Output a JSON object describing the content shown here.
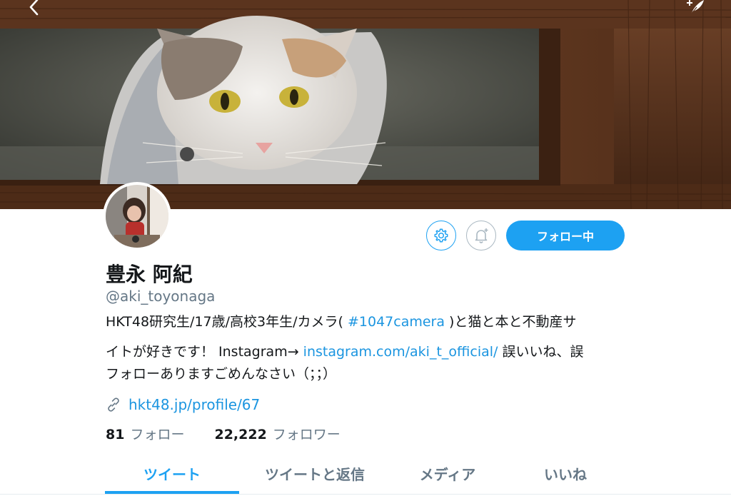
{
  "profile": {
    "display_name": "豊永 阿紀",
    "handle": "@aki_toyonaga",
    "bio": {
      "line1_text": "HKT48研究生/17歳/高校3年生/カメラ(",
      "line1_hashtag": "#1047camera",
      "line1_after": ")と猫と本と不動産サ",
      "line2_text": "イトが好きです！ Instagram→",
      "line2_link": "instagram.com/aki_t_official/",
      "line2_after": " 誤いいね、誤",
      "line3_text": "フォローありますごめんなさい（；；）"
    },
    "website": "hkt48.jp/profile/67"
  },
  "stats": {
    "following_count": "81",
    "following_label": "フォロー",
    "followers_count": "22,222",
    "followers_label": "フォロワー"
  },
  "actions": {
    "follow_label": "フォロー中",
    "settings_icon": "gear-icon",
    "notify_icon": "bell-plus-icon"
  },
  "nav": {
    "back_icon": "chevron-left-icon",
    "compose_icon": "feather-plus-icon"
  },
  "tabs": [
    {
      "label": "ツイート",
      "active": true
    },
    {
      "label": "ツイートと返信",
      "active": false
    },
    {
      "label": "メディア",
      "active": false
    },
    {
      "label": "いいね",
      "active": false
    }
  ],
  "colors": {
    "accent": "#1da1f2",
    "link": "#1b95e0",
    "secondary_text": "#657786"
  }
}
